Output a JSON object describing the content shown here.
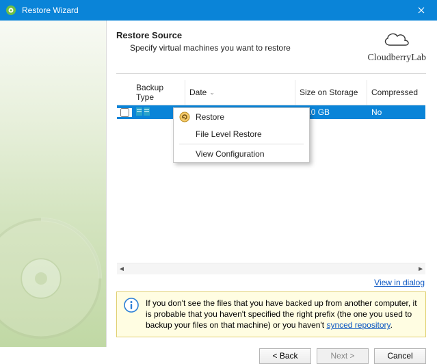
{
  "window": {
    "title": "Restore Wizard"
  },
  "header": {
    "title": "Restore Source",
    "subtitle": "Specify virtual machines you want to restore"
  },
  "brand": {
    "name": "CloudberryLab"
  },
  "table": {
    "columns": {
      "backup_type": "Backup Type",
      "date": "Date",
      "size": "Size on Storage",
      "compressed": "Compressed"
    },
    "rows": [
      {
        "checked": false,
        "type_icon": "vm-icon",
        "date": "",
        "size": "16.0 GB",
        "compressed": "No"
      }
    ]
  },
  "context_menu": {
    "items": {
      "restore": "Restore",
      "file_level": "File Level Restore",
      "view_config": "View Configuration"
    }
  },
  "links": {
    "view_in_dialog": "View in dialog",
    "synced_repository": "synced repository"
  },
  "info": {
    "text_pre": "If you don't see the files that you have backed up from another computer, it is probable that you haven't specified the right prefix (the one you used to backup your files on that machine) or you haven't "
  },
  "buttons": {
    "back": "< Back",
    "next": "Next >",
    "cancel": "Cancel"
  }
}
